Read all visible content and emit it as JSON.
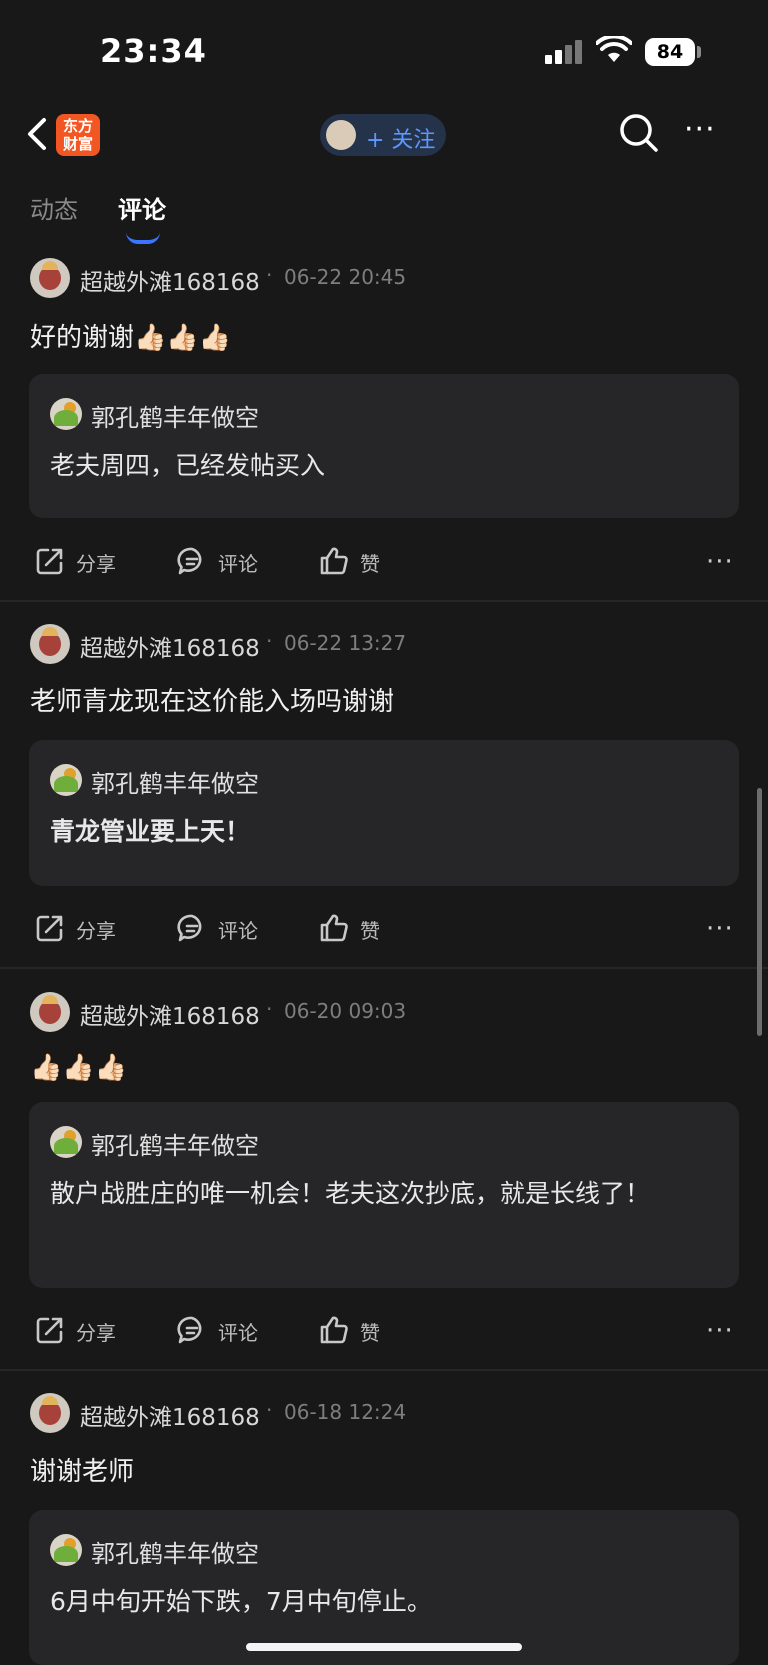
{
  "status_bar": {
    "time": "23:34",
    "battery": "84"
  },
  "nav": {
    "logo_text": "东方\n财富",
    "follow_label": "+ 关注"
  },
  "tabs": [
    {
      "label": "动态",
      "active": false
    },
    {
      "label": "评论",
      "active": true
    }
  ],
  "actions": {
    "share": "分享",
    "comment": "评论",
    "like": "赞"
  },
  "posts": [
    {
      "author": "超越外滩168168",
      "time": "06-22 20:45",
      "content": "好的谢谢👍🏻👍🏻👍🏻",
      "quote": {
        "author": "郭孔鹤丰年做空",
        "text": "老夫周四，已经发帖买入"
      }
    },
    {
      "author": "超越外滩168168",
      "time": "06-22 13:27",
      "content": "老师青龙现在这价能入场吗谢谢",
      "quote": {
        "author": "郭孔鹤丰年做空",
        "text": "青龙管业要上天！"
      }
    },
    {
      "author": "超越外滩168168",
      "time": "06-20 09:03",
      "content": "👍🏻👍🏻👍🏻",
      "quote": {
        "author": "郭孔鹤丰年做空",
        "text": "散户战胜庄的唯一机会！老夫这次抄底，就是长线了！"
      }
    },
    {
      "author": "超越外滩168168",
      "time": "06-18 12:24",
      "content": "谢谢老师",
      "quote": {
        "author": "郭孔鹤丰年做空",
        "text": "6月中旬开始下跌，7月中旬停止。"
      }
    }
  ],
  "colors": {
    "background": "#181818",
    "card": "#262628",
    "accent": "#3b74ff",
    "logo": "#f25623"
  }
}
